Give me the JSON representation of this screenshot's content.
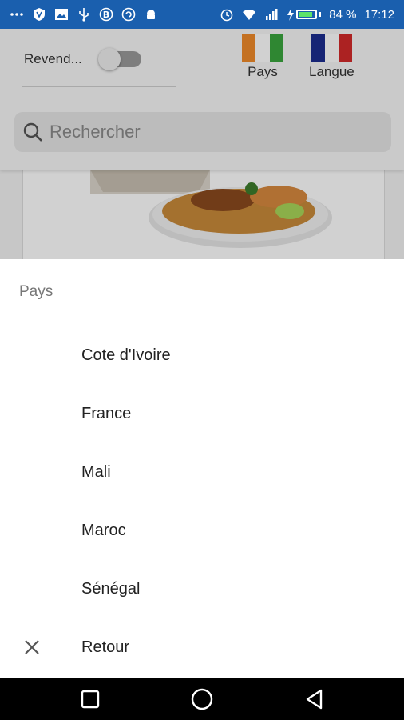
{
  "status_bar": {
    "battery_percent": "84 %",
    "time": "17:12",
    "battery_level": 0.84,
    "bg_color": "#1a5fae",
    "left_icons": [
      "more-icon",
      "shield-icon",
      "image-icon",
      "usb-icon",
      "bitcoin-icon",
      "sync-icon",
      "android-icon"
    ],
    "right_icons": [
      "alarm-icon",
      "wifi-icon",
      "signal-icon",
      "charging-icon",
      "battery-icon"
    ]
  },
  "header": {
    "reseller_label": "Revend...",
    "reseller_switch_on": false,
    "country_button_label": "Pays",
    "language_button_label": "Langue",
    "country_flag_colors": [
      "#f08a2a",
      "#ffffff",
      "#3aa53d"
    ],
    "language_flag_colors": [
      "#1c2d8f",
      "#ffffff",
      "#d22a2a"
    ]
  },
  "search": {
    "placeholder": "Rechercher"
  },
  "sheet": {
    "title": "Pays",
    "options": [
      {
        "label": "Cote d'Ivoire"
      },
      {
        "label": "France"
      },
      {
        "label": "Mali"
      },
      {
        "label": "Maroc"
      },
      {
        "label": "Sénégal"
      }
    ],
    "back_label": "Retour"
  },
  "nav_bar": {
    "icons": [
      "recents-square-icon",
      "home-circle-icon",
      "back-triangle-icon"
    ]
  }
}
